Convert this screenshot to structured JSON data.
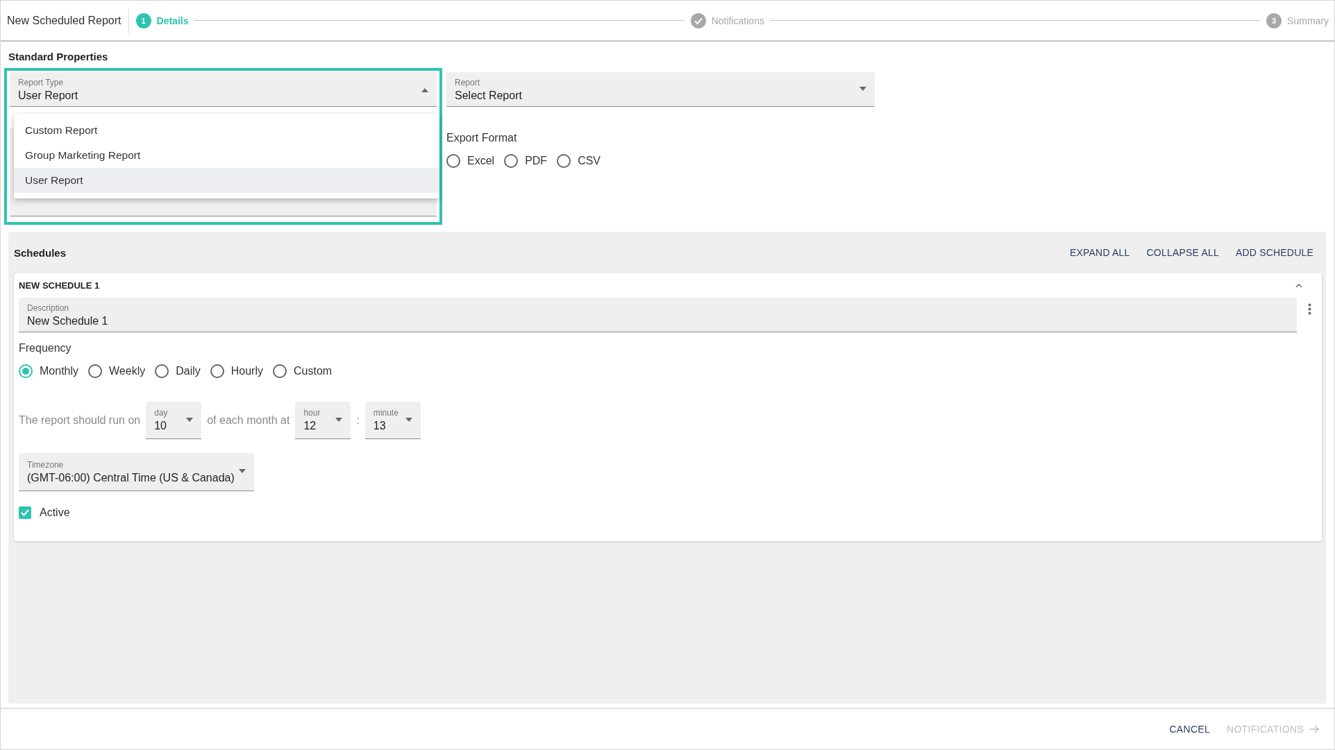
{
  "header": {
    "title": "New Scheduled Report",
    "steps": [
      {
        "number": "1",
        "label": "Details",
        "active": true,
        "completed": false
      },
      {
        "label": "Notifications",
        "active": false,
        "completed": true
      },
      {
        "number": "3",
        "label": "Summary",
        "active": false,
        "completed": false
      }
    ]
  },
  "standard_properties": {
    "heading": "Standard Properties",
    "report_type": {
      "label": "Report Type",
      "value": "User Report",
      "expanded": true,
      "options": [
        {
          "label": "Custom Report",
          "selected": false
        },
        {
          "label": "Group Marketing Report",
          "selected": false
        },
        {
          "label": "User Report",
          "selected": true
        }
      ]
    },
    "report": {
      "label": "Report",
      "value": "Select Report"
    },
    "export_format": {
      "label": "Export Format",
      "options": [
        {
          "label": "Excel",
          "selected": false
        },
        {
          "label": "PDF",
          "selected": false
        },
        {
          "label": "CSV",
          "selected": false
        }
      ]
    }
  },
  "schedules": {
    "heading": "Schedules",
    "actions": [
      "EXPAND ALL",
      "COLLAPSE ALL",
      "ADD SCHEDULE"
    ],
    "items": [
      {
        "title": "NEW SCHEDULE 1",
        "expanded": true,
        "description": {
          "label": "Description",
          "value": "New Schedule 1"
        },
        "frequency": {
          "label": "Frequency",
          "options": [
            {
              "label": "Monthly",
              "selected": true
            },
            {
              "label": "Weekly",
              "selected": false
            },
            {
              "label": "Daily",
              "selected": false
            },
            {
              "label": "Hourly",
              "selected": false
            },
            {
              "label": "Custom",
              "selected": false
            }
          ]
        },
        "run_text": "The report should run on",
        "day": {
          "label": "day",
          "value": "10"
        },
        "month_text": "of each month at",
        "hour": {
          "label": "hour",
          "value": "12"
        },
        "separator": ":",
        "minute": {
          "label": "minute",
          "value": "13"
        },
        "timezone": {
          "label": "Timezone",
          "value": "(GMT-06:00) Central Time (US & Canada)"
        },
        "active": {
          "label": "Active",
          "checked": true
        }
      }
    ]
  },
  "footer": {
    "buttons": [
      {
        "label": "CANCEL",
        "disabled": false
      },
      {
        "label": "NOTIFICATIONS",
        "disabled": true
      }
    ]
  }
}
